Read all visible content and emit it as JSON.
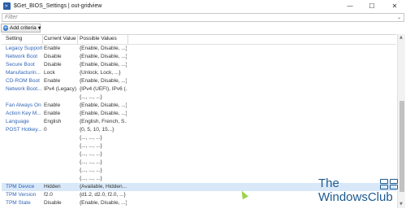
{
  "window": {
    "title": "$Get_BIOS_Settings | out-gridview",
    "icon": "powershell-icon",
    "minimize_glyph": "—",
    "maximize_glyph": "☐",
    "close_glyph": "✕"
  },
  "filter": {
    "placeholder": "Filter",
    "toggle_glyph": "⌄"
  },
  "criteria": {
    "label": "Add criteria",
    "plus_glyph": "+",
    "caret_glyph": "▼"
  },
  "table": {
    "columns": [
      "Setting",
      "Current Value",
      "Possible Values"
    ],
    "rows": [
      {
        "setting": "Legacy Support",
        "current": "Enable",
        "possible": "{Enable, Disable, ...}"
      },
      {
        "setting": "Network Boot",
        "current": "Disable",
        "possible": "{Enable, Disable, ...}"
      },
      {
        "setting": "Secure Boot",
        "current": "Disable",
        "possible": "{Enable, Disable, ...}"
      },
      {
        "setting": "Manufacturin...",
        "current": "Lock",
        "possible": "{Unlock, Lock, ...}"
      },
      {
        "setting": "CD-ROM Boot",
        "current": "Enable",
        "possible": "{Enable, Disable, ...}"
      },
      {
        "setting": "Network Boot...",
        "current": "IPv4 (Legacy)",
        "possible": "{IPv4 (UEFI), IPv6 (..."
      },
      {
        "setting": "",
        "current": "",
        "possible": "{..., ..., ...}"
      },
      {
        "setting": "Fan Always On",
        "current": "Enable",
        "possible": "{Enable, Disable, ...}"
      },
      {
        "setting": "Action Key M...",
        "current": "Enable",
        "possible": "{Enable, Disable, ...}"
      },
      {
        "setting": "Language",
        "current": "English",
        "possible": "{English, French, S..."
      },
      {
        "setting": "POST Hotkey...",
        "current": "0",
        "possible": "{0, 5, 10, 15...}"
      },
      {
        "setting": "",
        "current": "",
        "possible": "{..., ..., ...}"
      },
      {
        "setting": "",
        "current": "",
        "possible": "{..., ..., ...}"
      },
      {
        "setting": "",
        "current": "",
        "possible": "{..., ..., ...}"
      },
      {
        "setting": "",
        "current": "",
        "possible": "{..., ..., ...}"
      },
      {
        "setting": "",
        "current": "",
        "possible": "{..., ..., ...}"
      },
      {
        "setting": "",
        "current": "",
        "possible": "{..., ..., ...}"
      },
      {
        "setting": "TPM Device",
        "current": "Hidden",
        "possible": "{Available, Hidden..."
      },
      {
        "setting": "TPM Version",
        "current": "f2.0",
        "possible": "{d1.2, d2.0, f2.0, ...}"
      },
      {
        "setting": "TPM State",
        "current": "Disable",
        "possible": "{Enable, Disable, ...}"
      }
    ],
    "selected_index": 17
  },
  "scrollbar": {
    "up_glyph": "▲",
    "down_glyph": "▼"
  },
  "watermark": {
    "line1": "The",
    "line2": "WindowsClub"
  }
}
